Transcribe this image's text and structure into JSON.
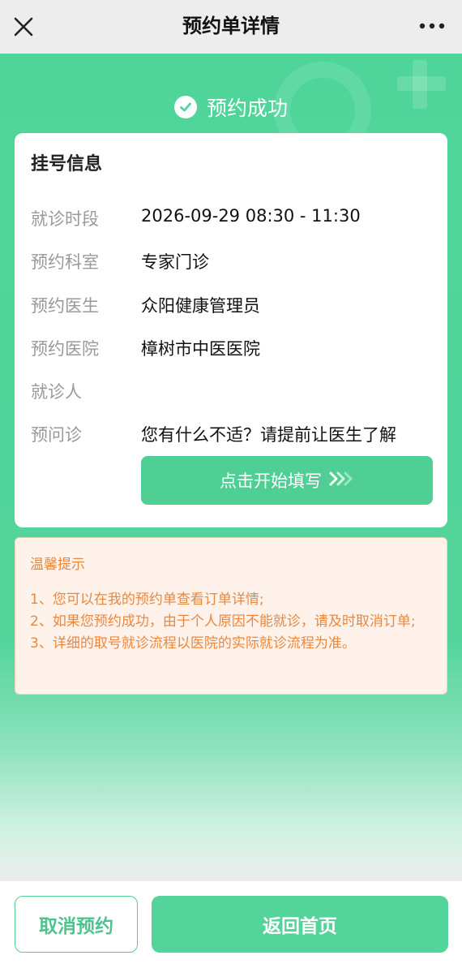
{
  "header": {
    "title": "预约单详情",
    "close_icon": "close-icon",
    "more_icon": "more-dots-icon"
  },
  "status": {
    "label": "预约成功",
    "icon": "check-circle-icon"
  },
  "registration": {
    "title": "挂号信息",
    "rows": [
      {
        "key": "就诊时段",
        "value": "2026-09-29 08:30 - 11:30"
      },
      {
        "key": "预约科室",
        "value": "专家门诊"
      },
      {
        "key": "预约医生",
        "value": "众阳健康管理员"
      },
      {
        "key": "预约医院",
        "value": "樟树市中医医院"
      },
      {
        "key": "就诊人",
        "value": ""
      },
      {
        "key": "预问诊",
        "value": "您有什么不适？请提前让医生了解"
      }
    ],
    "fill_button": "点击开始填写",
    "fill_icon": "double-chevron-right-icon"
  },
  "tips": {
    "title": "温馨提示",
    "items": [
      "1、您可以在我的预约单查看订单详情;",
      "2、如果您预约成功，由于个人原因不能就诊，请及时取消订单;",
      "3、详细的取号就诊流程以医院的实际就诊流程为准。"
    ]
  },
  "footer": {
    "cancel_label": "取消预约",
    "home_label": "返回首页"
  },
  "colors": {
    "accent": "#52d49b",
    "tips_text": "#e8883f",
    "tips_bg": "#fff2ea"
  }
}
